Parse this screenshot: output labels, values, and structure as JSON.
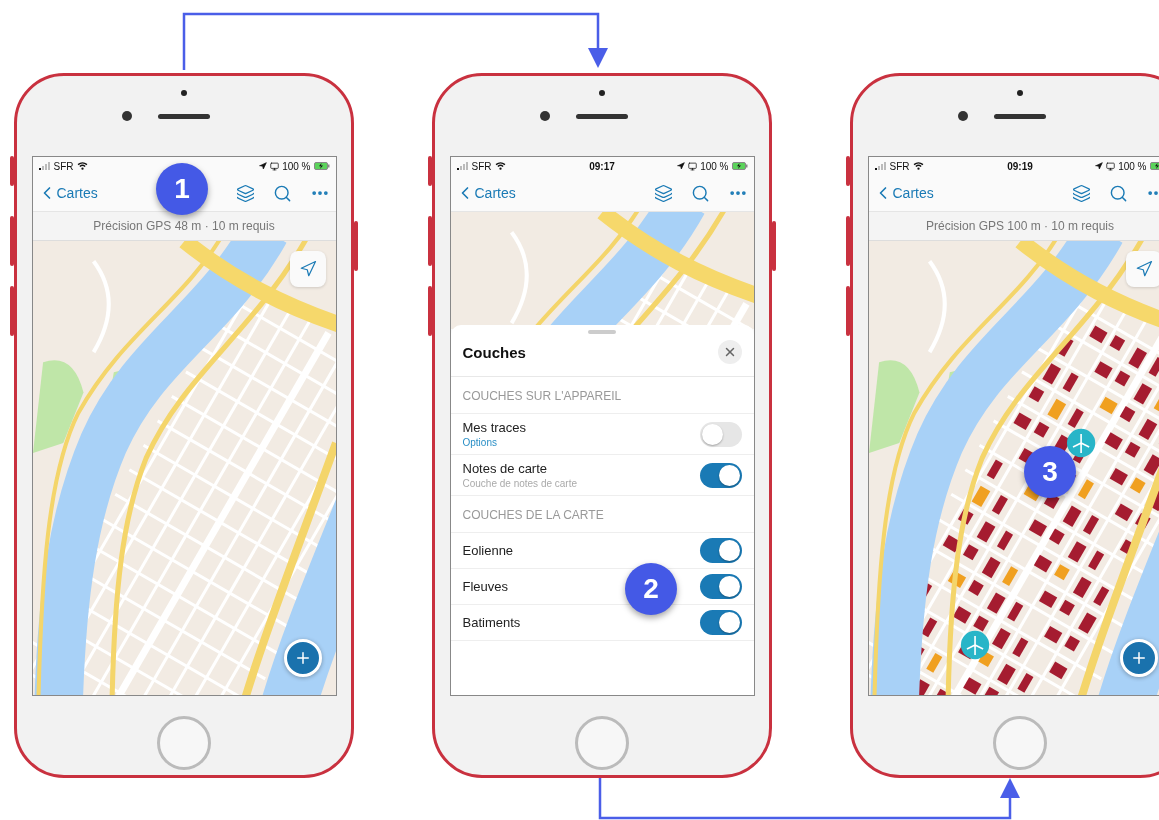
{
  "phones": [
    {
      "kind": "map",
      "badge": "1",
      "status": {
        "carrier": "SFR",
        "battery": "100 %"
      },
      "nav": {
        "back": "Cartes"
      },
      "gps_banner": "Précision GPS 48 m · 10 m requis",
      "buildings_layer": false
    },
    {
      "kind": "layers",
      "badge": "2",
      "status": {
        "carrier": "SFR",
        "time": "09:17",
        "battery": "100 %"
      },
      "nav": {
        "back": "Cartes"
      },
      "sheet": {
        "title": "Couches",
        "sections": [
          {
            "header": "COUCHES SUR L'APPAREIL",
            "items": [
              {
                "label": "Mes traces",
                "sublabel": {
                  "text": "Options",
                  "kind": "link"
                },
                "on": false
              },
              {
                "label": "Notes de carte",
                "sublabel": {
                  "text": "Couche de notes de carte",
                  "kind": "note"
                },
                "on": true
              }
            ]
          },
          {
            "header": "COUCHES DE LA CARTE",
            "items": [
              {
                "label": "Eolienne",
                "on": true
              },
              {
                "label": "Fleuves",
                "on": true
              },
              {
                "label": "Batiments",
                "on": true
              }
            ]
          }
        ]
      }
    },
    {
      "kind": "map",
      "badge": "3",
      "status": {
        "carrier": "SFR",
        "time": "09:19",
        "battery": "100 %"
      },
      "nav": {
        "back": "Cartes"
      },
      "gps_banner": "Précision GPS 100 m · 10 m requis",
      "buildings_layer": true
    }
  ]
}
